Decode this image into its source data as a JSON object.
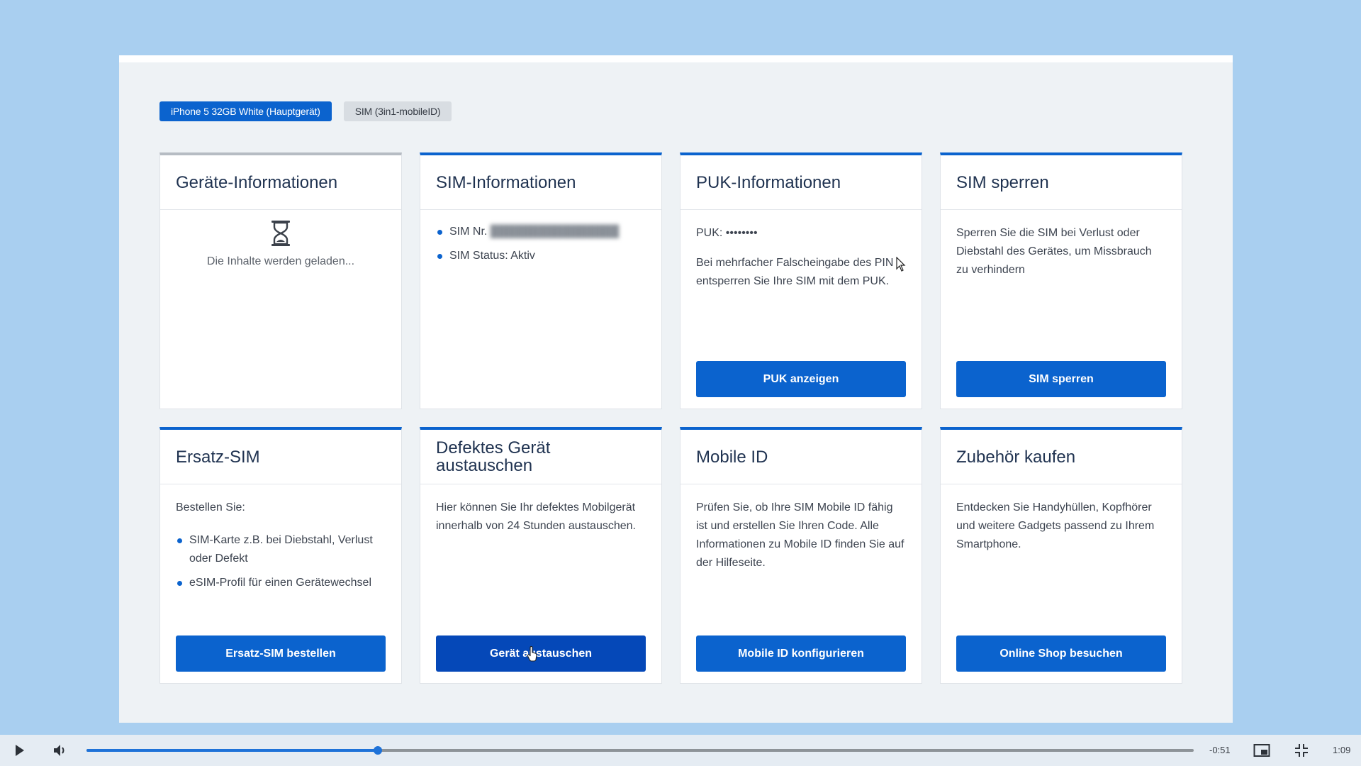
{
  "device_tabs": [
    {
      "label": "iPhone 5 32GB White (Hauptgerät)",
      "active": true
    },
    {
      "label": "SIM (3in1-mobileID)",
      "active": false
    }
  ],
  "cards": {
    "geraete": {
      "title": "Geräte-Informationen",
      "loading_text": "Die Inhalte werden geladen..."
    },
    "sim_info": {
      "title": "SIM-Informationen",
      "sim_nr_label": "SIM Nr.",
      "sim_status": "SIM Status: Aktiv"
    },
    "puk": {
      "title": "PUK-Informationen",
      "puk_line": "PUK: ••••••••",
      "description": "Bei mehrfacher Falscheingabe des PIN entsperren Sie Ihre SIM mit dem PUK.",
      "button": "PUK anzeigen"
    },
    "sim_sperren": {
      "title": "SIM sperren",
      "description": "Sperren Sie die SIM bei Verlust oder Diebstahl des Gerätes, um Missbrauch zu verhindern",
      "button": "SIM sperren"
    },
    "ersatz_sim": {
      "title": "Ersatz-SIM",
      "intro": "Bestellen Sie:",
      "items": [
        "SIM-Karte z.B. bei Diebstahl, Verlust oder Defekt",
        "eSIM-Profil für einen Gerätewechsel"
      ],
      "button": "Ersatz-SIM bestellen"
    },
    "defektes_geraet": {
      "title": "Defektes Gerät austauschen",
      "description": "Hier können Sie Ihr defektes Mobilgerät innerhalb von 24 Stunden austauschen.",
      "button": "Gerät austauschen"
    },
    "mobile_id": {
      "title": "Mobile ID",
      "description": "Prüfen Sie, ob Ihre SIM Mobile ID fähig ist und erstellen Sie Ihren Code. Alle Informationen zu Mobile ID finden Sie auf der Hilfeseite.",
      "button": "Mobile ID konfigurieren"
    },
    "zubehoer": {
      "title": "Zubehör kaufen",
      "description": "Entdecken Sie Handyhüllen, Kopfhörer und weitere Gadgets passend zu Ihrem Smartphone.",
      "button": "Online Shop besuchen"
    }
  },
  "player": {
    "remaining": "-0:51",
    "duration": "1:09",
    "progress_fraction": 0.263,
    "icons": [
      "play-icon",
      "volume-icon",
      "picture-in-picture-icon",
      "exit-fullscreen-icon"
    ]
  },
  "colors": {
    "accent": "#0b63ce",
    "background": "#a9cff0",
    "panel": "#eef2f5"
  }
}
